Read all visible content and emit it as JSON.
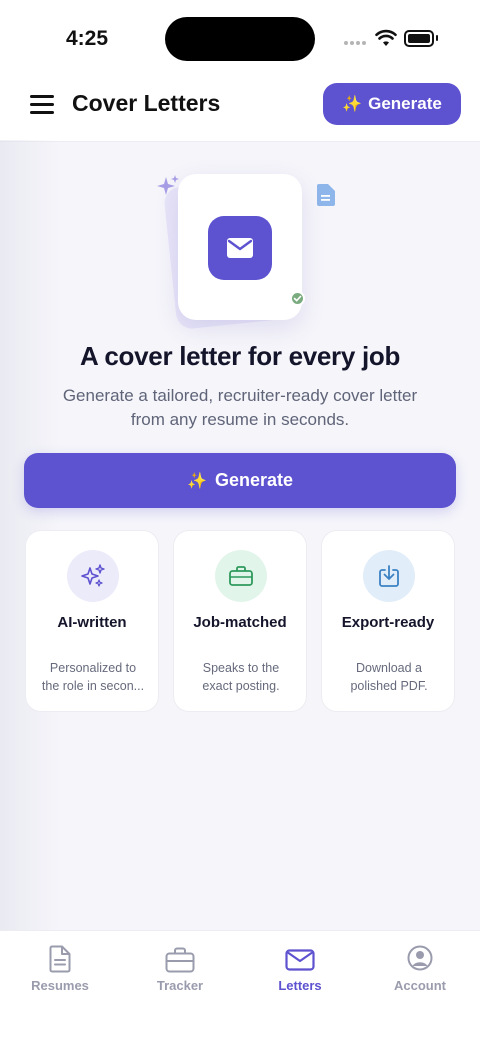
{
  "status_bar": {
    "time": "4:25"
  },
  "header": {
    "title": "Cover Letters",
    "generate_label": "Generate",
    "sparkle_glyph": "✨"
  },
  "hero": {
    "title": "A cover letter for every job",
    "subtitle_line1": "Generate a tailored, recruiter-ready cover letter",
    "subtitle_line2": "from any resume in seconds.",
    "generate_label": "Generate",
    "sparkle_glyph": "✨",
    "icons": [
      "sparkles-icon",
      "document-icon",
      "envelope-icon",
      "check-icon"
    ]
  },
  "features": [
    {
      "title": "AI-written",
      "desc_line1": "Personalized to",
      "desc_line2": "the role in secon...",
      "icon": "sparkles-icon",
      "color": "#5d52cf",
      "bg": "#ecebfa"
    },
    {
      "title": "Job-matched",
      "desc_line1": "Speaks to the",
      "desc_line2": "exact posting.",
      "icon": "briefcase-icon",
      "color": "#2e9a5c",
      "bg": "#e2f5ea"
    },
    {
      "title": "Export-ready",
      "desc_line1": "Download a",
      "desc_line2": "polished PDF.",
      "icon": "download-icon",
      "color": "#3b82c4",
      "bg": "#e1edf9"
    }
  ],
  "tabs": [
    {
      "label": "Resumes",
      "icon": "document-icon",
      "active": false
    },
    {
      "label": "Tracker",
      "icon": "briefcase-icon",
      "active": false
    },
    {
      "label": "Letters",
      "icon": "envelope-icon",
      "active": true
    },
    {
      "label": "Account",
      "icon": "user-circle-icon",
      "active": false
    }
  ],
  "colors": {
    "accent": "#5d52cf",
    "background": "#f5f5fa",
    "inactive_tab": "#9a9cad"
  }
}
